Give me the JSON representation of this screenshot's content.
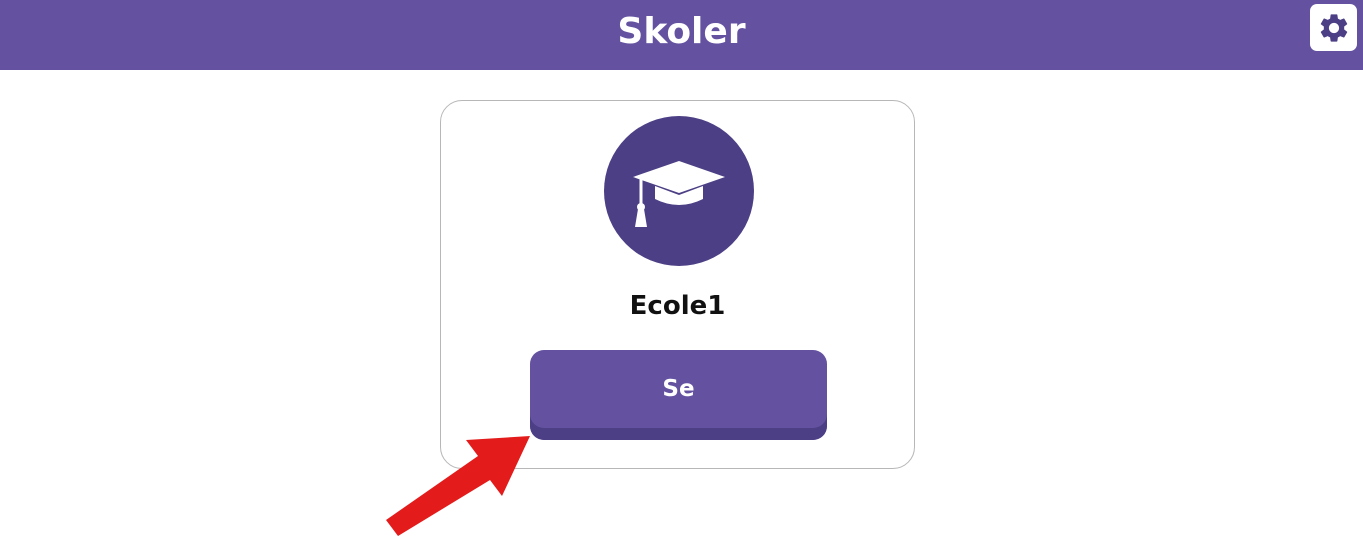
{
  "header": {
    "title": "Skoler",
    "background_color": "#6452a1",
    "settings_icon": "gear-icon"
  },
  "school_card": {
    "icon": "graduation-cap-icon",
    "avatar_color": "#4c3f85",
    "name": "Ecole1",
    "view_button_label": "Se",
    "button_color": "#6452a1"
  },
  "annotation": {
    "type": "arrow",
    "color": "#e31b1b"
  }
}
